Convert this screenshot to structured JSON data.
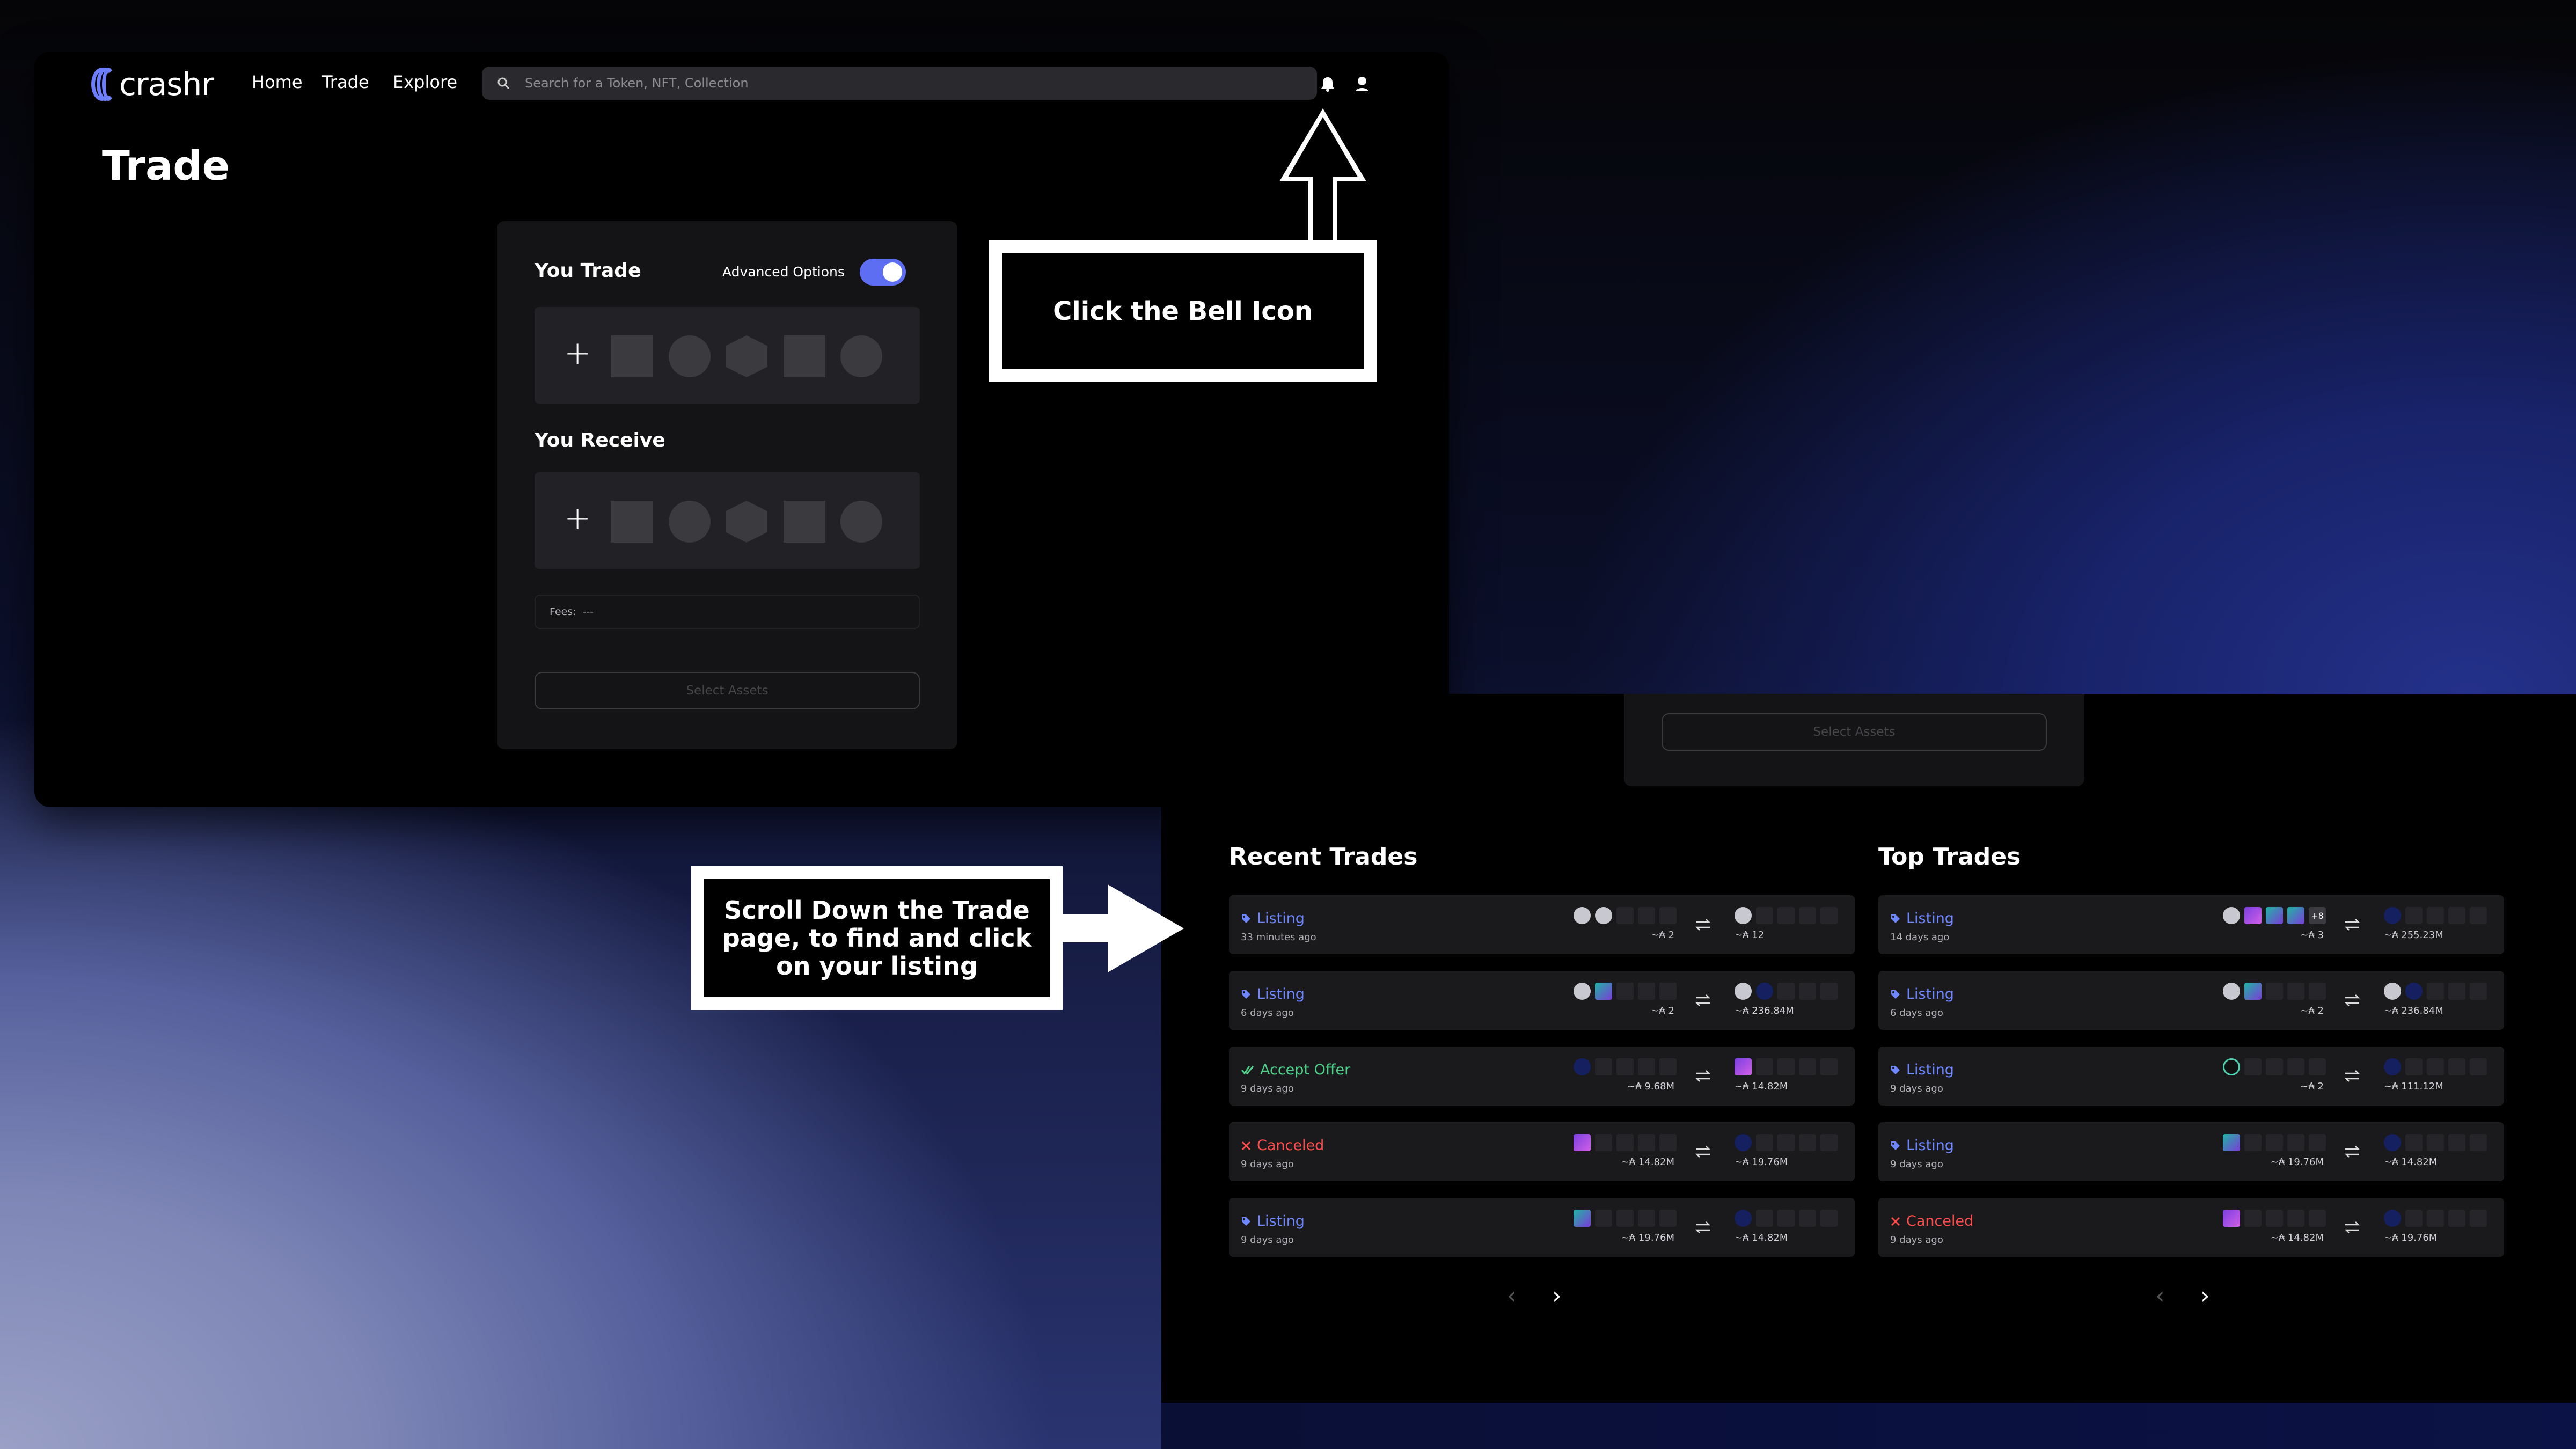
{
  "app": {
    "logo": "crashr"
  },
  "nav": {
    "items": [
      "Home",
      "Trade",
      "Explore"
    ],
    "search_placeholder": "Search for a Token, NFT, Collection"
  },
  "trade": {
    "title": "Trade",
    "you_trade": "You Trade",
    "advanced_options": "Advanced Options",
    "advanced_enabled": true,
    "you_receive": "You Receive",
    "fees_label": "Fees:",
    "fees_value": "---",
    "select_assets": "Select Assets"
  },
  "annotations": {
    "bell": "Click the Bell Icon",
    "scroll": "Scroll Down the Trade page, to find and click on your listing"
  },
  "recent": {
    "title": "Recent Trades",
    "rows": [
      {
        "status": "Listing",
        "kind": "listing",
        "time": "33 minutes ago",
        "give": "~₳ 2",
        "get": "~₳ 12",
        "gs": [
          "coin",
          "coin",
          "e",
          "e",
          "e"
        ],
        "rs": [
          "coin",
          "e",
          "e",
          "e",
          "e"
        ]
      },
      {
        "status": "Listing",
        "kind": "listing",
        "time": "6 days ago",
        "give": "~₳ 2",
        "get": "~₳ 236.84M",
        "gs": [
          "coin",
          "img2",
          "e",
          "e",
          "e"
        ],
        "rs": [
          "coin",
          "blue",
          "e",
          "e",
          "e"
        ]
      },
      {
        "status": "Accept Offer",
        "kind": "accept",
        "time": "9 days ago",
        "give": "~₳ 9.68M",
        "get": "~₳ 14.82M",
        "gs": [
          "blue",
          "e",
          "e",
          "e",
          "e"
        ],
        "rs": [
          "img",
          "e",
          "e",
          "e",
          "e"
        ]
      },
      {
        "status": "Canceled",
        "kind": "canceled",
        "time": "9 days ago",
        "give": "~₳ 14.82M",
        "get": "~₳ 19.76M",
        "gs": [
          "img",
          "e",
          "e",
          "e",
          "e"
        ],
        "rs": [
          "blue",
          "e",
          "e",
          "e",
          "e"
        ]
      },
      {
        "status": "Listing",
        "kind": "listing",
        "time": "9 days ago",
        "give": "~₳ 19.76M",
        "get": "~₳ 14.82M",
        "gs": [
          "img2",
          "e",
          "e",
          "e",
          "e"
        ],
        "rs": [
          "blue",
          "e",
          "e",
          "e",
          "e"
        ]
      }
    ]
  },
  "top": {
    "title": "Top Trades",
    "rows": [
      {
        "status": "Listing",
        "kind": "listing",
        "time": "14 days ago",
        "give": "~₳ 3",
        "get": "~₳ 255.23M",
        "gs": [
          "coin",
          "img",
          "img2",
          "img2",
          "plus8"
        ],
        "plus": "+8",
        "rs": [
          "blue",
          "e",
          "e",
          "e",
          "e"
        ]
      },
      {
        "status": "Listing",
        "kind": "listing",
        "time": "6 days ago",
        "give": "~₳ 2",
        "get": "~₳ 236.84M",
        "gs": [
          "coin",
          "img2",
          "e",
          "e",
          "e"
        ],
        "rs": [
          "coin",
          "blue",
          "e",
          "e",
          "e"
        ]
      },
      {
        "status": "Listing",
        "kind": "listing",
        "time": "9 days ago",
        "give": "~₳ 2",
        "get": "~₳ 111.12M",
        "gs": [
          "ring",
          "e",
          "e",
          "e",
          "e"
        ],
        "rs": [
          "blue",
          "e",
          "e",
          "e",
          "e"
        ]
      },
      {
        "status": "Listing",
        "kind": "listing",
        "time": "9 days ago",
        "give": "~₳ 19.76M",
        "get": "~₳ 14.82M",
        "gs": [
          "img2",
          "e",
          "e",
          "e",
          "e"
        ],
        "rs": [
          "blue",
          "e",
          "e",
          "e",
          "e"
        ]
      },
      {
        "status": "Canceled",
        "kind": "canceled",
        "time": "9 days ago",
        "give": "~₳ 14.82M",
        "get": "~₳ 19.76M",
        "gs": [
          "img",
          "e",
          "e",
          "e",
          "e"
        ],
        "rs": [
          "blue",
          "e",
          "e",
          "e",
          "e"
        ]
      }
    ]
  },
  "colors": {
    "listing": "#6e86ff",
    "accept": "#4fd18a",
    "canceled": "#ff4d4d",
    "accent": "#5d6ef2"
  }
}
